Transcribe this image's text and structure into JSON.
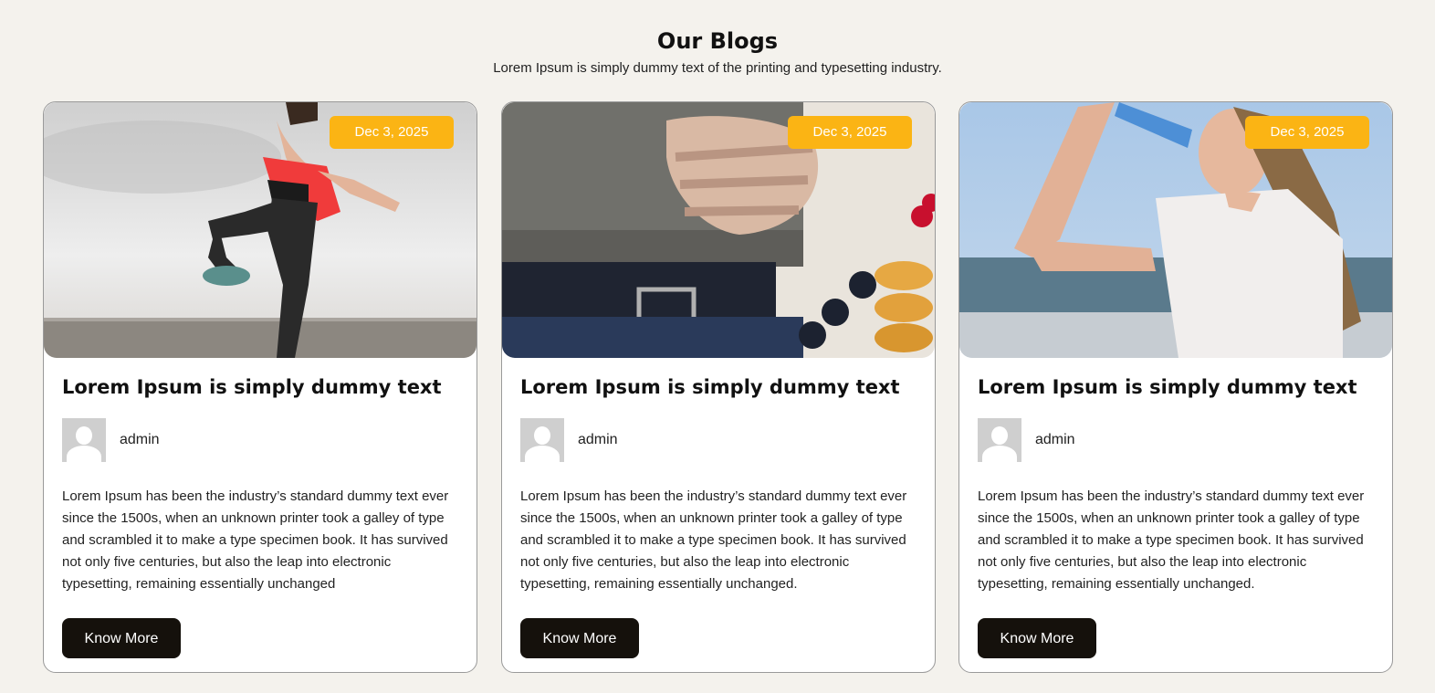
{
  "section": {
    "title": "Our Blogs",
    "subtitle": "Lorem Ipsum is simply dummy text of the printing and typesetting industry."
  },
  "posts": [
    {
      "date": "Dec 3, 2025",
      "title": "Lorem Ipsum is simply dummy text",
      "author": "admin",
      "excerpt": "Lorem Ipsum has been the industry’s standard dummy text ever since the 1500s, when an unknown printer took a galley of type and scrambled it to make a type specimen book. It has survived not only five centuries, but also the leap into electronic typesetting, remaining essentially unchanged",
      "button": "Know More",
      "image": "woman-exercising-on-beach"
    },
    {
      "date": "Dec 3, 2025",
      "title": "Lorem Ipsum is simply dummy text",
      "author": "admin",
      "excerpt": "Lorem Ipsum has been the industry’s standard dummy text ever since the 1500s, when an unknown printer took a galley of type and scrambled it to make a type specimen book. It has survived not only five centuries, but also the leap into electronic typesetting, remaining essentially unchanged.",
      "button": "Know More",
      "image": "man-holding-belly-with-pancakes"
    },
    {
      "date": "Dec 3, 2025",
      "title": "Lorem Ipsum is simply dummy text",
      "author": "admin",
      "excerpt": "Lorem Ipsum has been the industry’s standard dummy text ever since the 1500s, when an unknown printer took a galley of type and scrambled it to make a type specimen book. It has survived not only five centuries, but also the leap into electronic typesetting, remaining essentially unchanged.",
      "button": "Know More",
      "image": "woman-drinking-water-by-sea"
    }
  ],
  "colors": {
    "badge": "#fbb414",
    "button": "#15110c",
    "background": "#f4f2ed"
  }
}
